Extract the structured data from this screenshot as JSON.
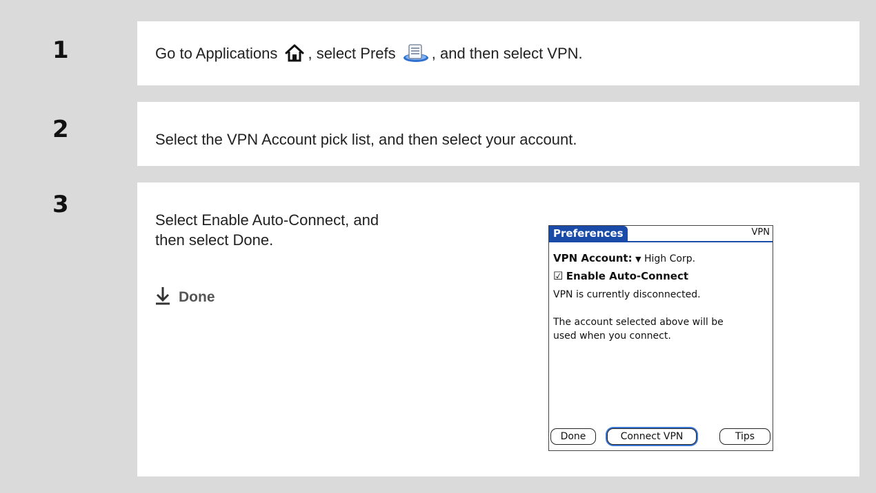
{
  "steps": [
    {
      "number": "1",
      "text_before_apps": "Go to Applications",
      "text_between": ", select Prefs",
      "text_after": ", and then select VPN."
    },
    {
      "number": "2",
      "text": "Select the VPN Account pick list, and then select your account."
    },
    {
      "number": "3",
      "text_line1": "Select Enable Auto-Connect, and",
      "text_line2": "then select Done.",
      "done_label": "Done"
    }
  ],
  "palm": {
    "tab_title": "Preferences",
    "panel_name": "VPN",
    "account_label": "VPN Account:",
    "account_value": "High Corp.",
    "checkbox_label": "Enable Auto-Connect",
    "checkbox_checked": true,
    "status": "VPN is currently disconnected.",
    "info_line1": "The account selected above will be",
    "info_line2": "used when you connect.",
    "buttons": [
      "Done",
      "Connect VPN",
      "Tips"
    ]
  },
  "colors": {
    "title_bar": "#1a4ba8",
    "frame": "#dadada",
    "focus_ring": "#3a78d8"
  }
}
